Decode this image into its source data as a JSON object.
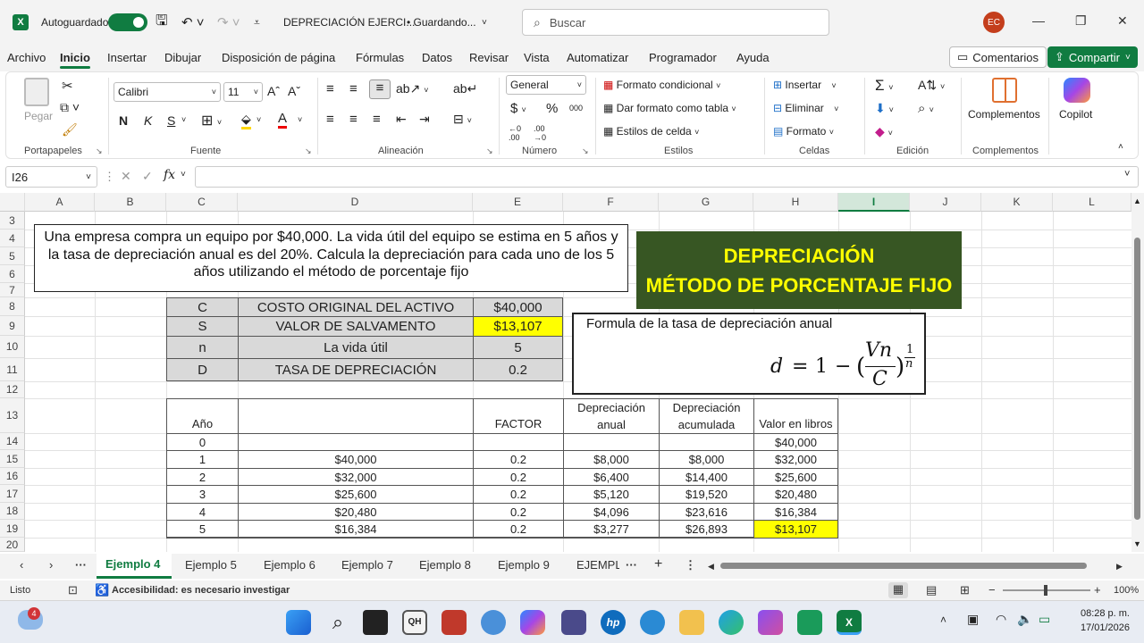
{
  "titlebar": {
    "autosave": "Autoguardado",
    "doc_title": "DEPRECIACIÓN EJERCI...",
    "save_status": "• Guardando...",
    "search_placeholder": "Buscar",
    "avatar": "EC"
  },
  "menu": [
    "Archivo",
    "Inicio",
    "Insertar",
    "Dibujar",
    "Disposición de página",
    "Fórmulas",
    "Datos",
    "Revisar",
    "Vista",
    "Automatizar",
    "Programador",
    "Ayuda"
  ],
  "buttons": {
    "comments": "Comentarios",
    "share": "Compartir"
  },
  "ribbon": {
    "groups": [
      "Portapapeles",
      "Fuente",
      "Alineación",
      "Número",
      "Estilos",
      "Celdas",
      "Edición",
      "Complementos"
    ],
    "paste": "Pegar",
    "font_name": "Calibri",
    "font_size": "11",
    "number_format": "General",
    "bold": "N",
    "italic": "K",
    "underline": "S",
    "cond_format": "Formato condicional",
    "table_format": "Dar formato como tabla",
    "cell_styles": "Estilos de celda",
    "insert": "Insertar",
    "delete": "Eliminar",
    "format": "Formato",
    "addins": "Complementos",
    "copilot": "Copilot"
  },
  "formula_bar": {
    "namebox": "I26",
    "fx": "fx",
    "content": ""
  },
  "columns": [
    "A",
    "B",
    "C",
    "D",
    "E",
    "F",
    "G",
    "H",
    "I",
    "J",
    "K",
    "L"
  ],
  "rows": [
    "3",
    "4",
    "5",
    "6",
    "7",
    "8",
    "9",
    "10",
    "11",
    "12",
    "13",
    "14",
    "15",
    "16",
    "17",
    "18",
    "19",
    "20"
  ],
  "sheet": {
    "problem": "Una empresa compra un equipo por $40,000. La vida útil del equipo se estima en 5 años y la tasa de depreciación anual es del 20%. Calcula la depreciación para cada uno de los 5 años utilizando el método de porcentaje fijo",
    "title_line1": "DEPRECIACIÓN",
    "title_line2": "MÉTODO DE PORCENTAJE FIJO",
    "params": [
      {
        "sym": "C",
        "label": "COSTO ORIGINAL DEL ACTIVO",
        "value": "$40,000"
      },
      {
        "sym": "S",
        "label": "VALOR DE SALVAMENTO",
        "value": "$13,107"
      },
      {
        "sym": "n",
        "label": "La vida útil",
        "value": "5"
      },
      {
        "sym": "D",
        "label": "TASA DE DEPRECIACIÓN",
        "value": "0.2"
      }
    ],
    "formula_title": "Formula de la tasa de depreciación anual",
    "formula": {
      "lhs": "d",
      "eq": "=",
      "one": "1",
      "minus": "−",
      "num": "Vn",
      "den": "C",
      "exp_num": "1",
      "exp_den": "n"
    },
    "table_headers": {
      "year": "Año",
      "factor": "FACTOR",
      "dep_anual": [
        "Depreciación",
        "anual"
      ],
      "dep_acum": [
        "Depreciación",
        "acumulada"
      ],
      "book": "Valor en libros"
    },
    "table_rows": [
      {
        "year": "0",
        "base": "",
        "factor": "",
        "dep": "",
        "acum": "",
        "book": "$40,000"
      },
      {
        "year": "1",
        "base": "$40,000",
        "factor": "0.2",
        "dep": "$8,000",
        "acum": "$8,000",
        "book": "$32,000"
      },
      {
        "year": "2",
        "base": "$32,000",
        "factor": "0.2",
        "dep": "$6,400",
        "acum": "$14,400",
        "book": "$25,600"
      },
      {
        "year": "3",
        "base": "$25,600",
        "factor": "0.2",
        "dep": "$5,120",
        "acum": "$19,520",
        "book": "$20,480"
      },
      {
        "year": "4",
        "base": "$20,480",
        "factor": "0.2",
        "dep": "$4,096",
        "acum": "$23,616",
        "book": "$16,384"
      },
      {
        "year": "5",
        "base": "$16,384",
        "factor": "0.2",
        "dep": "$3,277",
        "acum": "$26,893",
        "book": "$13,107"
      }
    ]
  },
  "tabs": [
    "Ejemplo 4",
    "Ejemplo 5",
    "Ejemplo 6",
    "Ejemplo 7",
    "Ejemplo 8",
    "Ejemplo 9",
    "EJEMPL"
  ],
  "status": {
    "ready": "Listo",
    "accessibility": "Accesibilidad: es necesario investigar",
    "zoom": "100%"
  },
  "taskbar": {
    "time": "08:28 p. m.",
    "date": "17/01/2026",
    "weather_badge": "4"
  },
  "colors": {
    "excel_green": "#107c41",
    "title_bg": "#375623",
    "title_text": "#ffff00",
    "highlight": "#ffff00",
    "param_bg": "#d9d9d9"
  }
}
